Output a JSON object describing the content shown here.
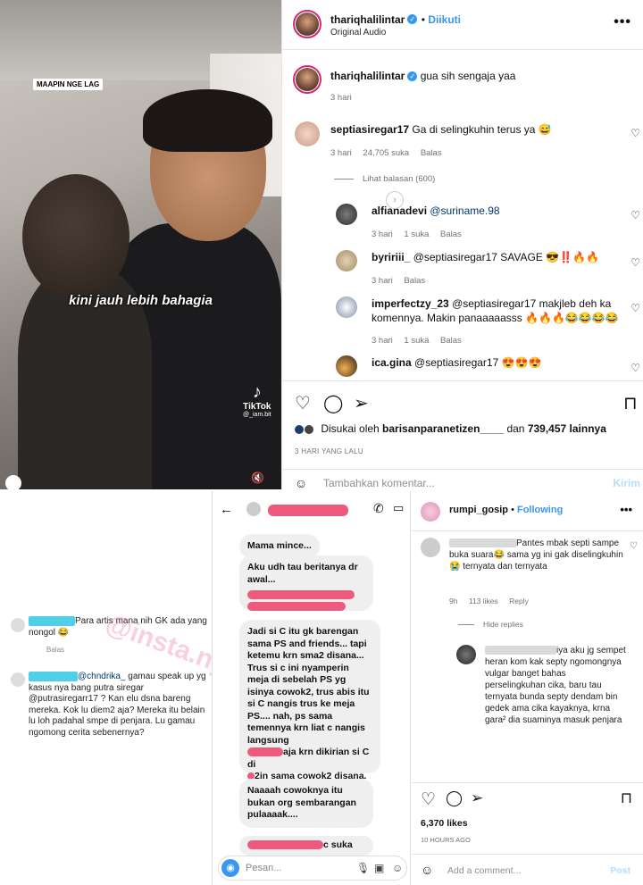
{
  "colors": {
    "accent": "#3897f0",
    "story_ring": "#d62976",
    "redact_pink": "#ee5a7e",
    "redact_cyan": "#4fd0e8"
  },
  "video": {
    "lag_badge": "MAAPIN NGE LAG",
    "caption": "kini jauh lebih bahagia",
    "tiktok_label": "TikTok",
    "tiktok_user": "@_iam.bit",
    "icons": [
      "tiktok-icon",
      "mute-icon"
    ]
  },
  "post": {
    "username": "thariqhalilintar",
    "follow": "Diikuti",
    "audio": "Original Audio",
    "caption_text": "gua sih sengaja yaa",
    "caption_time": "3 hari",
    "comments": [
      {
        "user": "septiasiregar17",
        "text": "Ga di selingkuhin terus ya 😅",
        "time": "3 hari",
        "likes": "24,705 suka",
        "reply": "Balas",
        "view_replies": "Lihat balasan (600)"
      }
    ],
    "replies": [
      {
        "user": "alfianadevi",
        "text": "@suriname.98",
        "time": "3 hari",
        "likes": "1 suka",
        "reply": "Balas"
      },
      {
        "user": "byririii_",
        "text": "@septiasiregar17 SAVAGE 😎‼️🔥🔥",
        "time": "3 hari",
        "likes": "",
        "reply": "Balas"
      },
      {
        "user": "imperfectzy_23",
        "text": "@septiasiregar17 makjleb deh ka komennya. Makin panaaaaasss 🔥🔥🔥😂😂😂😂",
        "time": "3 hari",
        "likes": "1 suka",
        "reply": "Balas"
      },
      {
        "user": "ica.gina",
        "text": "@septiasiregar17 😍😍😍",
        "time": "",
        "likes": "",
        "reply": ""
      }
    ],
    "liked_by_prefix": "Disukai oleh ",
    "liked_by_user": "barisanparanetizen____",
    "liked_by_suffix": " dan ",
    "liked_count": "739,457 lainnya",
    "date": "3 HARI YANG LALU",
    "add_comment_placeholder": "Tambahkan komentar...",
    "post_button": "Kirim"
  },
  "left_comments": {
    "c1_text": "Para artis mana nih GK ada yang nongol 😂",
    "c1_reply": "Balas",
    "c2_handle": "@chndrika_",
    "c2_text": " gamau speak up yg kasus nya bang putra siregar @putrasiregarr17 ? Kan elu dsna bareng mereka. Kok lu diem2 aja? Mereka itu belain lu loh padahal smpe di penjara. Lu gamau ngomong cerita sebenernya?",
    "watermark": "@insta.ny"
  },
  "chat": {
    "bubbles": [
      "Mama mince...",
      "Aku udh tau beritanya dr awal...",
      "Jadi si C itu gk barengan sama PS and friends... tapi ketemu krn sma2 disana... Trus si c ini nyamperin meja di sebelah PS yg isinya cowok2, trus abis itu si C nangis trus ke meja PS.... nah, ps sama temennya krn liat c nangis langsung",
      "aja krn dikirian si C di",
      "2in sama cowok2 disana.",
      "Naaaah cowoknya itu bukan org sembarangan pulaaaak....",
      "c suka"
    ],
    "input_placeholder": "Pesan..."
  },
  "rumpi": {
    "username": "rumpi_gosip",
    "follow": "Following",
    "comment_text": "Pantes mbak septi sampe buka suara😂 sama yg ini gak diselingkuhin 😭 ternyata dan ternyata",
    "comment_time": "9h",
    "comment_likes": "113 likes",
    "comment_reply": "Reply",
    "hide_replies": "Hide replies",
    "reply_text": "iya aku jg sempet heran kom kak septy ngomongnya vulgar banget bahas perselingkuhan cika, baru tau ternyata bunda septy dendam bin gedek ama cika kayaknya, krna gara² dia suaminya masuk penjara",
    "likes": "6,370 likes",
    "date": "10 HOURS AGO",
    "add_comment": "Add a comment...",
    "post": "Post"
  }
}
